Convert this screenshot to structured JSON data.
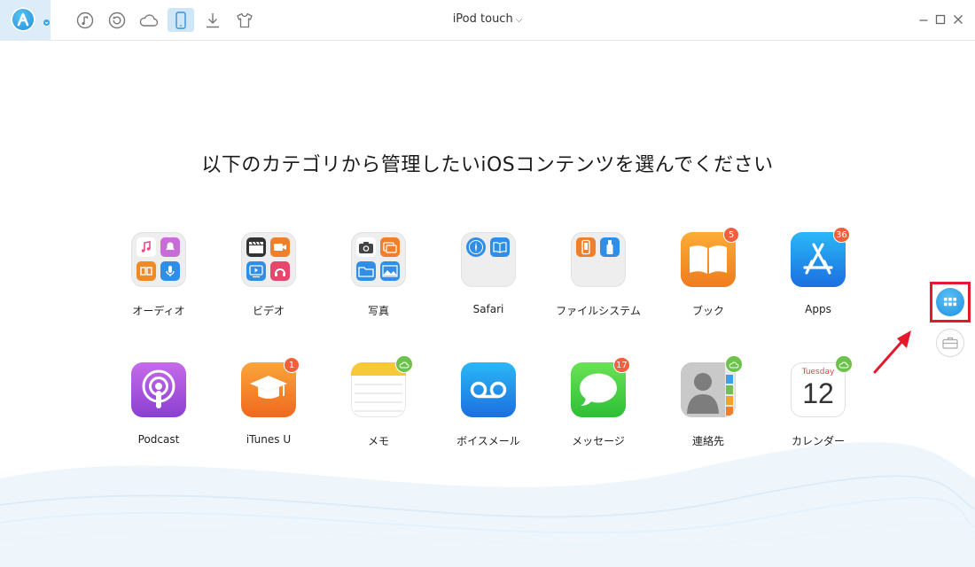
{
  "header": {
    "device_name": "iPod touch",
    "toolbar": [
      {
        "icon": "music-icon"
      },
      {
        "icon": "restore-icon"
      },
      {
        "icon": "cloud-icon"
      },
      {
        "icon": "device-icon",
        "active": true
      },
      {
        "icon": "download-icon"
      },
      {
        "icon": "tshirt-icon"
      }
    ],
    "accent": "#3aa4e8"
  },
  "main": {
    "headline": "以下のカテゴリから管理したいiOSコンテンツを選んでください",
    "categories": [
      {
        "label": "オーディオ",
        "icon": "audio-folder-icon"
      },
      {
        "label": "ビデオ",
        "icon": "video-folder-icon"
      },
      {
        "label": "写真",
        "icon": "photo-folder-icon"
      },
      {
        "label": "Safari",
        "icon": "safari-folder-icon"
      },
      {
        "label": "ファイルシステム",
        "icon": "file-system-folder-icon"
      },
      {
        "label": "ブック",
        "icon": "books-icon",
        "badge": "5"
      },
      {
        "label": "Apps",
        "icon": "app-store-icon",
        "badge": "36"
      },
      {
        "label": "Podcast",
        "icon": "podcast-icon"
      },
      {
        "label": "iTunes U",
        "icon": "itunes-u-icon",
        "badge": "1"
      },
      {
        "label": "メモ",
        "icon": "notes-icon",
        "cloud": true
      },
      {
        "label": "ボイスメール",
        "icon": "voicemail-icon"
      },
      {
        "label": "メッセージ",
        "icon": "messages-icon",
        "badge": "17"
      },
      {
        "label": "連絡先",
        "icon": "contacts-icon",
        "cloud": true
      },
      {
        "label": "カレンダー",
        "icon": "calendar-icon",
        "cloud": true,
        "weekday": "Tuesday",
        "day": "12"
      }
    ]
  },
  "side": {
    "category_view": {
      "icon": "grid-icon",
      "active": true
    },
    "toolbox": {
      "icon": "toolbox-icon"
    }
  }
}
